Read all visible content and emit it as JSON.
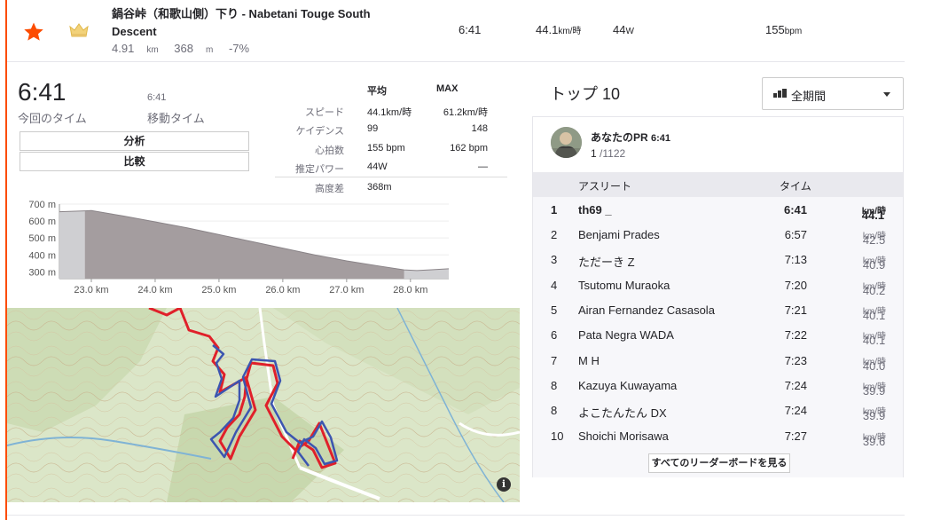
{
  "segment": {
    "title": "鍋谷峠（和歌山側）下り - Nabetani Touge South Descent",
    "distance_value": "4.91",
    "distance_unit": "km",
    "elev_value": "368",
    "elev_unit": "m",
    "grade": "-7%",
    "time": "6:41",
    "speed_value": "44.1",
    "speed_unit": "km/時",
    "power_value": "44",
    "power_unit": "W",
    "hr_value": "155",
    "hr_unit": "bpm",
    "colors": {
      "star": "#fc4c02",
      "crown": "#e9c46a"
    }
  },
  "summary": {
    "elapsed_time": "6:41",
    "elapsed_label": "今回のタイム",
    "moving_time": "6:41",
    "moving_label": "移動タイム",
    "analyze_button": "分析",
    "compare_button": "比較"
  },
  "stats": {
    "avg_header": "平均",
    "max_header": "MAX",
    "rows": [
      {
        "label": "スピード",
        "avg": "44.1km/時",
        "max": "61.2km/時"
      },
      {
        "label": "ケイデンス",
        "avg": "99",
        "max": "148"
      },
      {
        "label": "心拍数",
        "avg": "155 bpm",
        "max": "162 bpm"
      },
      {
        "label": "推定パワー",
        "avg": "44W",
        "max": "—"
      },
      {
        "label": "高度差",
        "avg": "368m",
        "max": ""
      }
    ]
  },
  "chart_data": {
    "type": "area",
    "title": "",
    "x": [
      22.5,
      22.9,
      23.0,
      23.5,
      24.0,
      24.5,
      25.0,
      25.5,
      26.0,
      26.5,
      27.0,
      27.5,
      27.9,
      28.1,
      28.3,
      28.6
    ],
    "values": [
      655,
      660,
      662,
      630,
      595,
      560,
      520,
      480,
      440,
      400,
      365,
      335,
      312,
      308,
      312,
      318
    ],
    "highlight_range": [
      22.9,
      27.9
    ],
    "y_ticks": [
      "700 m",
      "600 m",
      "500 m",
      "400 m",
      "300 m"
    ],
    "y_tick_values": [
      700,
      600,
      500,
      400,
      300
    ],
    "x_ticks": [
      "23.0 km",
      "24.0 km",
      "25.0 km",
      "26.0 km",
      "27.0 km",
      "28.0 km"
    ],
    "x_tick_values": [
      23,
      24,
      25,
      26,
      27,
      28
    ],
    "xlim": [
      22.5,
      28.6
    ],
    "ylim": [
      260,
      700
    ],
    "colors": {
      "fill": "#a49d9f",
      "fill_outside": "#cfcfd2",
      "line": "#8a8488"
    }
  },
  "map": {
    "info_icon_label": "i",
    "colors": {
      "route_a": "#e0202a",
      "route_b": "#3c55b0"
    }
  },
  "leaderboard": {
    "title": "トップ 10",
    "period": "全期間",
    "pr_label": "あなたのPR",
    "pr_time": "6:41",
    "pr_rank": "1",
    "pr_total": " /1122",
    "col_athlete": "アスリート",
    "col_time": "タイム",
    "rows": [
      {
        "rank": "1",
        "name": "th69 _",
        "time": "6:41",
        "speed": "44.1",
        "unit": "km/時",
        "me": true
      },
      {
        "rank": "2",
        "name": "Benjami Prades",
        "time": "6:57",
        "speed": "42.5",
        "unit": "km/時"
      },
      {
        "rank": "3",
        "name": "ただーき Z",
        "time": "7:13",
        "speed": "40.9",
        "unit": "km/時"
      },
      {
        "rank": "4",
        "name": "Tsutomu Muraoka",
        "time": "7:20",
        "speed": "40.2",
        "unit": "km/時"
      },
      {
        "rank": "5",
        "name": "Airan Fernandez Casasola",
        "time": "7:21",
        "speed": "40.1",
        "unit": "km/時"
      },
      {
        "rank": "6",
        "name": "Pata Negra WADA",
        "time": "7:22",
        "speed": "40.1",
        "unit": "km/時"
      },
      {
        "rank": "7",
        "name": "M H",
        "time": "7:23",
        "speed": "40.0",
        "unit": "km/時"
      },
      {
        "rank": "8",
        "name": "Kazuya Kuwayama",
        "time": "7:24",
        "speed": "39.9",
        "unit": "km/時"
      },
      {
        "rank": "8",
        "name": "よこたんたん DX",
        "time": "7:24",
        "speed": "39.9",
        "unit": "km/時"
      },
      {
        "rank": "10",
        "name": "Shoichi Morisawa",
        "time": "7:27",
        "speed": "39.6",
        "unit": "km/時"
      }
    ],
    "full_button": "すべてのリーダーボードを見る"
  }
}
